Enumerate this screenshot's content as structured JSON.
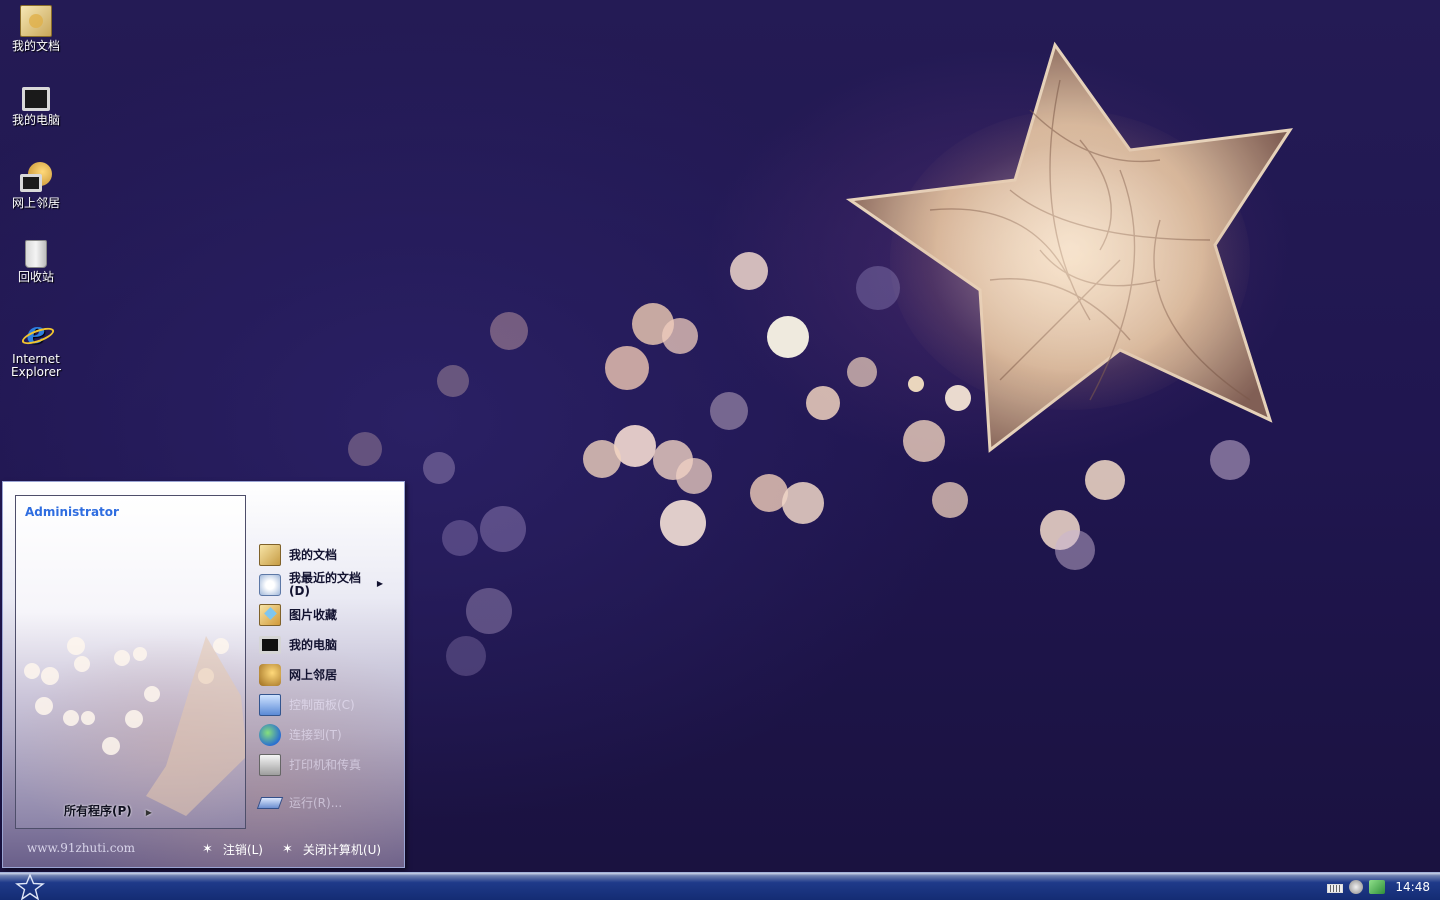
{
  "desktop": {
    "icons": [
      {
        "label": "我的文档",
        "icon": "my-documents-icon"
      },
      {
        "label": "我的电脑",
        "icon": "my-computer-icon"
      },
      {
        "label": "网上邻居",
        "icon": "network-places-icon"
      },
      {
        "label": "回收站",
        "icon": "recycle-bin-icon"
      },
      {
        "label": "Internet Explorer",
        "icon": "internet-explorer-icon"
      }
    ]
  },
  "start_menu": {
    "user_name": "Administrator",
    "all_programs_label": "所有程序(P)",
    "right_items": [
      {
        "label": "我的文档",
        "icon": "my-documents-icon"
      },
      {
        "label": "我最近的文档(D)",
        "icon": "recent-documents-icon",
        "has_submenu": true
      },
      {
        "label": "图片收藏",
        "icon": "my-pictures-icon"
      },
      {
        "label": "我的电脑",
        "icon": "my-computer-icon"
      },
      {
        "label": "网上邻居",
        "icon": "network-places-icon"
      },
      {
        "label": "控制面板(C)",
        "icon": "control-panel-icon"
      },
      {
        "label": "连接到(T)",
        "icon": "connect-to-icon"
      },
      {
        "label": "打印机和传真",
        "icon": "printers-faxes-icon"
      },
      {
        "label": "运行(R)...",
        "icon": "run-icon"
      }
    ],
    "footer": {
      "site_url": "www.91zhuti.com",
      "logoff_label": "注销(L)",
      "shutdown_label": "关闭计算机(U)"
    }
  },
  "taskbar": {
    "start_icon": "star-start-icon",
    "tray_icons": [
      "keyboard-icon",
      "volume-icon",
      "network-status-icon"
    ],
    "clock": "14:48"
  },
  "colors": {
    "wallpaper": "#20184a",
    "taskbar": "#142c73",
    "user_name": "#2f6de0"
  }
}
